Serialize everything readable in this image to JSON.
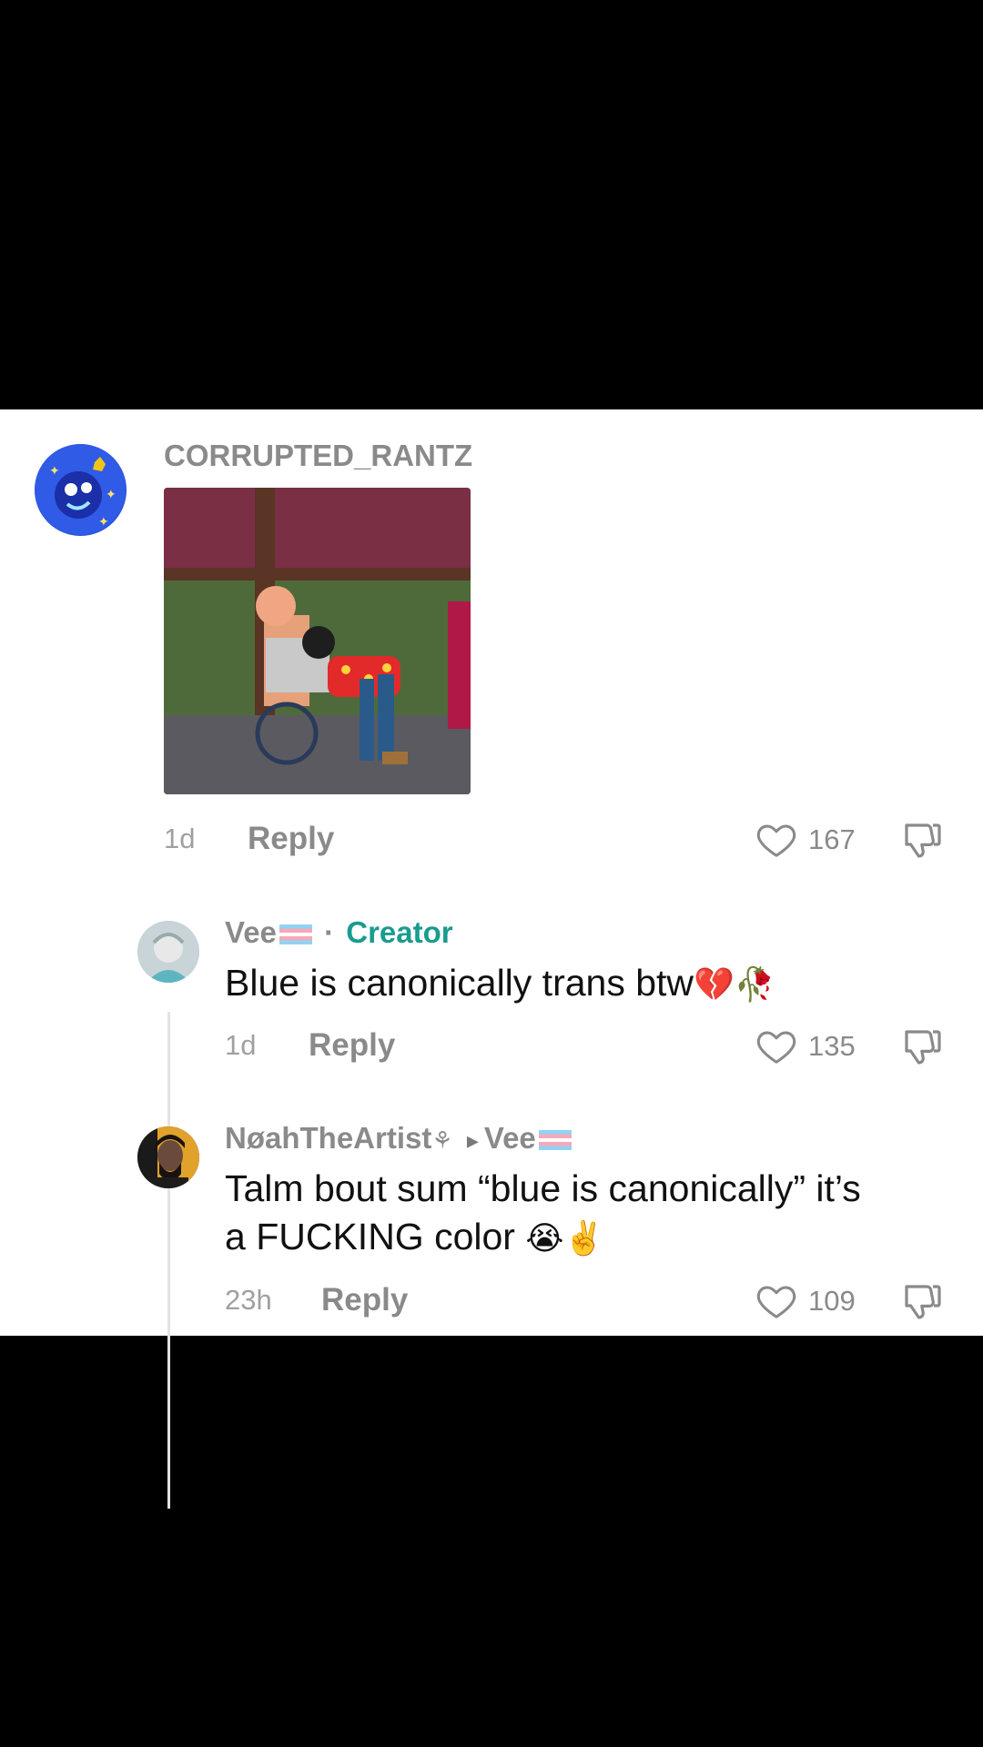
{
  "comments": [
    {
      "username": "CORRUPTED_RANTZ",
      "image_alt": "cartoon image reply",
      "time": "1d",
      "reply_label": "Reply",
      "likes": "167"
    },
    {
      "username": "Vee",
      "separator": "·",
      "badge": "Creator",
      "text": "Blue is canonically trans btw",
      "emoji": "💔🥀",
      "time": "1d",
      "reply_label": "Reply",
      "likes": "135"
    },
    {
      "username": "NøahTheArtist",
      "user_symbol": "⚘",
      "reply_to_arrow": "▸",
      "reply_to": "Vee",
      "text_line1": "Talm bout sum “blue is canonically” it’s",
      "text_line2": "a FUCKING color",
      "emoji": "😭✌️",
      "time": "23h",
      "reply_label": "Reply",
      "likes": "109"
    }
  ],
  "colors": {
    "creator_badge": "#1a9b8f",
    "username": "#8a8a8a",
    "background": "#ffffff"
  },
  "icons": [
    "heart-outline-icon",
    "dislike-icon"
  ]
}
